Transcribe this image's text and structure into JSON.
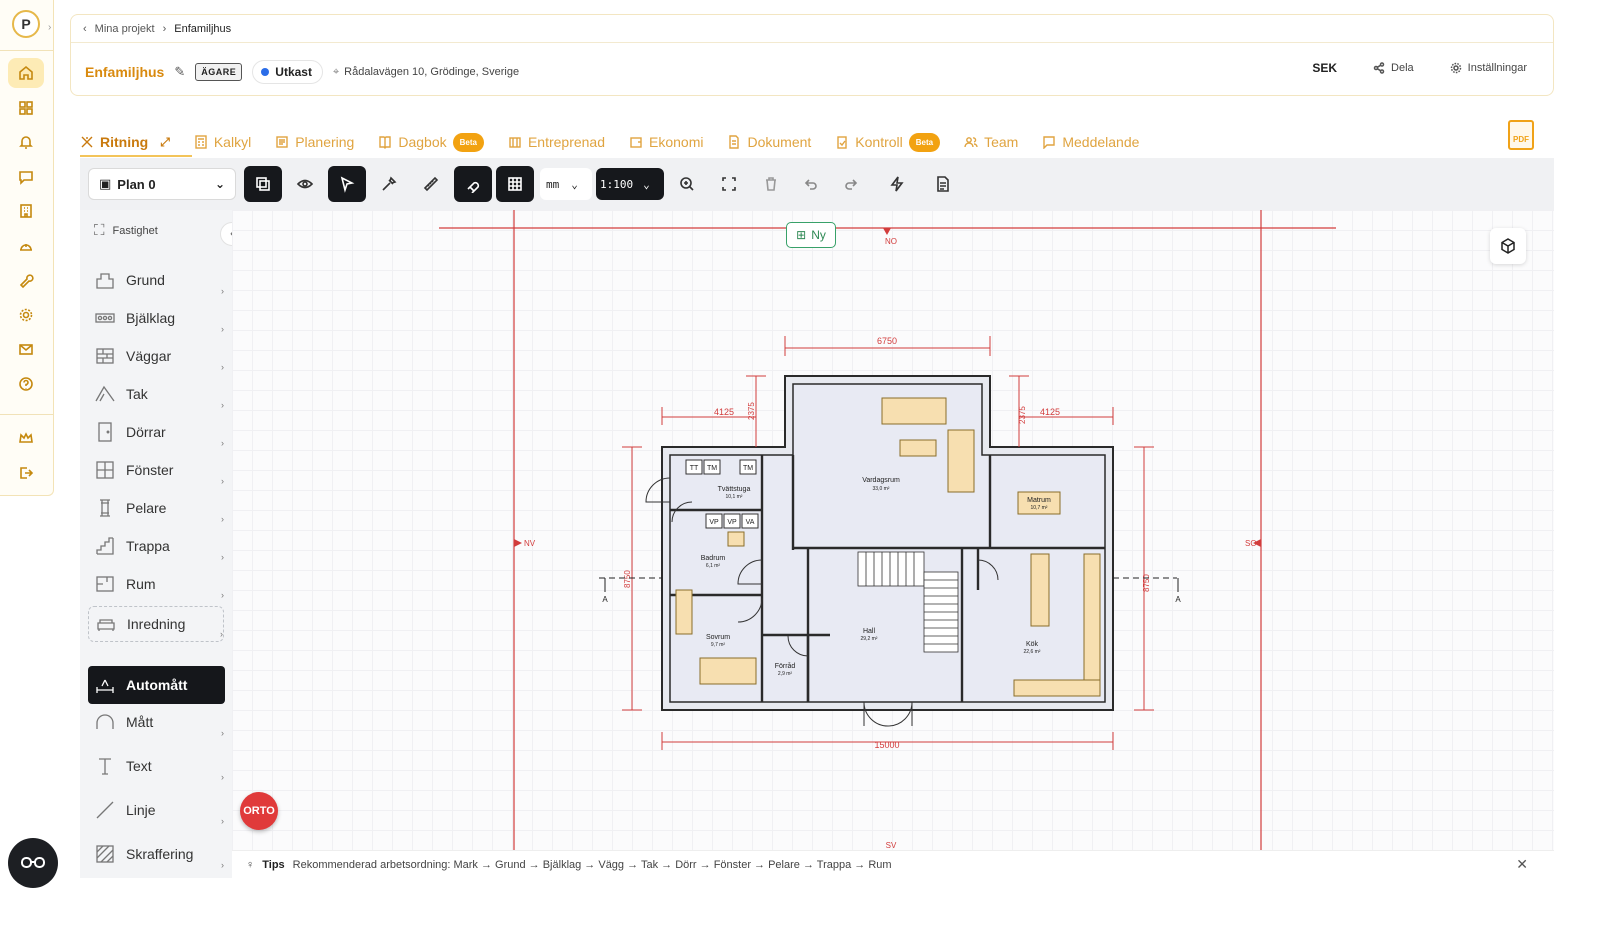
{
  "breadcrumb": {
    "parent": "Mina projekt",
    "current": "Enfamiljhus"
  },
  "project": {
    "name": "Enfamiljhus",
    "role_badge": "ÄGARE",
    "status": "Utkast",
    "address": "Rådalavägen 10, Grödinge, Sverige"
  },
  "header_actions": {
    "currency": "SEK",
    "share": "Dela",
    "settings": "Inställningar"
  },
  "tabs": [
    {
      "label": "Ritning",
      "active": true
    },
    {
      "label": "Kalkyl"
    },
    {
      "label": "Planering"
    },
    {
      "label": "Dagbok",
      "badge": "Beta"
    },
    {
      "label": "Entreprenad"
    },
    {
      "label": "Ekonomi"
    },
    {
      "label": "Dokument"
    },
    {
      "label": "Kontroll",
      "badge": "Beta"
    },
    {
      "label": "Team"
    },
    {
      "label": "Meddelande"
    }
  ],
  "pdf_label": "PDF",
  "toolbar": {
    "plan": "Plan 0",
    "unit": "mm",
    "scale": "1:100"
  },
  "side_panel": {
    "top_item": "Fastighet",
    "tools": [
      "Grund",
      "Bjälklag",
      "Väggar",
      "Tak",
      "Dörrar",
      "Fönster",
      "Pelare",
      "Trappa",
      "Rum",
      "Inredning"
    ],
    "tools2": [
      "Automått",
      "Mått",
      "Text",
      "Linje",
      "Skraffering"
    ],
    "active_tool": "Automått"
  },
  "canvas": {
    "new_button": "Ny",
    "orto": "ORTO",
    "compass": {
      "n": "NO",
      "w": "NV",
      "e": "SO",
      "s": "SV"
    },
    "dims": {
      "top": "6750",
      "left_top": "4125",
      "right_top": "4125",
      "left_vert": "2375",
      "right_vert": "2375",
      "bottom": "15000",
      "left_height": "8750",
      "right_height": "8750"
    },
    "section_marker": "A",
    "rooms": [
      {
        "name": "Vardagsrum",
        "area": "33,0 m²"
      },
      {
        "name": "Tvättstuga",
        "area": "10,1 m²"
      },
      {
        "name": "Matrum",
        "area": "10,7 m²"
      },
      {
        "name": "Badrum",
        "area": "6,1 m²"
      },
      {
        "name": "Hall",
        "area": "29,2 m²"
      },
      {
        "name": "Sovrum",
        "area": "9,7 m²"
      },
      {
        "name": "Förråd",
        "area": "2,9 m²"
      },
      {
        "name": "Kök",
        "area": "22,6 m²"
      }
    ],
    "fixtures": {
      "tt": "TT",
      "tm": "TM",
      "vp": "VP",
      "va": "VA"
    }
  },
  "tips": {
    "label": "Tips",
    "text": "Rekommenderad arbetsordning: Mark → Grund → Bjälklag → Vägg → Tak → Dörr → Fönster → Pelare → Trappa → Rum"
  },
  "colors": {
    "accent": "#d98a0f",
    "dimension": "#d23c3c",
    "dark": "#16181c"
  }
}
